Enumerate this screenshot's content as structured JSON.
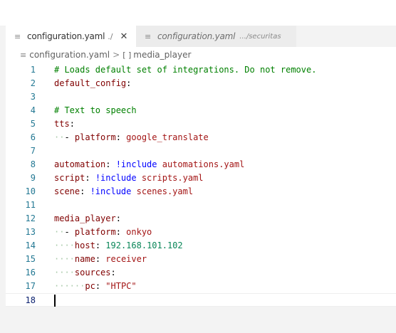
{
  "tabs": [
    {
      "label": "configuration.yaml",
      "flag": "./",
      "close": "✕",
      "icon": "file-lines-icon",
      "active": true
    },
    {
      "label": "configuration.yaml",
      "description": ".../securitas",
      "icon": "file-lines-icon",
      "active": false
    }
  ],
  "breadcrumb": {
    "file": "configuration.yaml",
    "separator": ">",
    "symbol_icon": "[ ]",
    "symbol": "media_player"
  },
  "editor": {
    "cursor_line": 18,
    "lines": [
      {
        "n": "1",
        "tokens": [
          {
            "t": "# Loads default set of integrations. Do not remove.",
            "c": "comment"
          }
        ]
      },
      {
        "n": "2",
        "tokens": [
          {
            "t": "default_config",
            "c": "key"
          },
          {
            "t": ":",
            "c": "plain"
          }
        ]
      },
      {
        "n": "3",
        "tokens": []
      },
      {
        "n": "4",
        "tokens": [
          {
            "t": "# Text to speech",
            "c": "comment"
          }
        ]
      },
      {
        "n": "5",
        "tokens": [
          {
            "t": "tts",
            "c": "key"
          },
          {
            "t": ":",
            "c": "plain"
          }
        ]
      },
      {
        "n": "6",
        "tokens": [
          {
            "t": "··",
            "c": "ws"
          },
          {
            "t": "- ",
            "c": "dash"
          },
          {
            "t": "platform",
            "c": "key"
          },
          {
            "t": ": ",
            "c": "plain"
          },
          {
            "t": "google_translate",
            "c": "str"
          }
        ]
      },
      {
        "n": "7",
        "tokens": []
      },
      {
        "n": "8",
        "tokens": [
          {
            "t": "automation",
            "c": "key"
          },
          {
            "t": ": ",
            "c": "plain"
          },
          {
            "t": "!include",
            "c": "tag"
          },
          {
            "t": " automations.yaml",
            "c": "str"
          }
        ]
      },
      {
        "n": "9",
        "tokens": [
          {
            "t": "script",
            "c": "key"
          },
          {
            "t": ": ",
            "c": "plain"
          },
          {
            "t": "!include",
            "c": "tag"
          },
          {
            "t": " scripts.yaml",
            "c": "str"
          }
        ]
      },
      {
        "n": "10",
        "tokens": [
          {
            "t": "scene",
            "c": "key"
          },
          {
            "t": ": ",
            "c": "plain"
          },
          {
            "t": "!include",
            "c": "tag"
          },
          {
            "t": " scenes.yaml",
            "c": "str"
          }
        ]
      },
      {
        "n": "11",
        "tokens": []
      },
      {
        "n": "12",
        "tokens": [
          {
            "t": "media_player",
            "c": "key"
          },
          {
            "t": ":",
            "c": "plain"
          }
        ]
      },
      {
        "n": "13",
        "tokens": [
          {
            "t": "··",
            "c": "ws"
          },
          {
            "t": "- ",
            "c": "dash"
          },
          {
            "t": "platform",
            "c": "key"
          },
          {
            "t": ": ",
            "c": "plain"
          },
          {
            "t": "onkyo",
            "c": "str"
          }
        ]
      },
      {
        "n": "14",
        "tokens": [
          {
            "t": "····",
            "c": "ws"
          },
          {
            "t": "host",
            "c": "key"
          },
          {
            "t": ": ",
            "c": "plain"
          },
          {
            "t": "192.168.101.102",
            "c": "num"
          }
        ]
      },
      {
        "n": "15",
        "tokens": [
          {
            "t": "····",
            "c": "ws"
          },
          {
            "t": "name",
            "c": "key"
          },
          {
            "t": ": ",
            "c": "plain"
          },
          {
            "t": "receiver",
            "c": "str"
          }
        ]
      },
      {
        "n": "16",
        "tokens": [
          {
            "t": "····",
            "c": "ws"
          },
          {
            "t": "sources",
            "c": "key"
          },
          {
            "t": ":",
            "c": "plain"
          }
        ]
      },
      {
        "n": "17",
        "tokens": [
          {
            "t": "······",
            "c": "ws"
          },
          {
            "t": "pc",
            "c": "key"
          },
          {
            "t": ": ",
            "c": "plain"
          },
          {
            "t": "\"HTPC\"",
            "c": "str"
          }
        ]
      },
      {
        "n": "18",
        "tokens": []
      }
    ]
  },
  "colors": {
    "comment": "#008000",
    "key": "#800000",
    "string": "#a31515",
    "number": "#098658",
    "tag": "#0000ff",
    "line_number": "#237893"
  }
}
